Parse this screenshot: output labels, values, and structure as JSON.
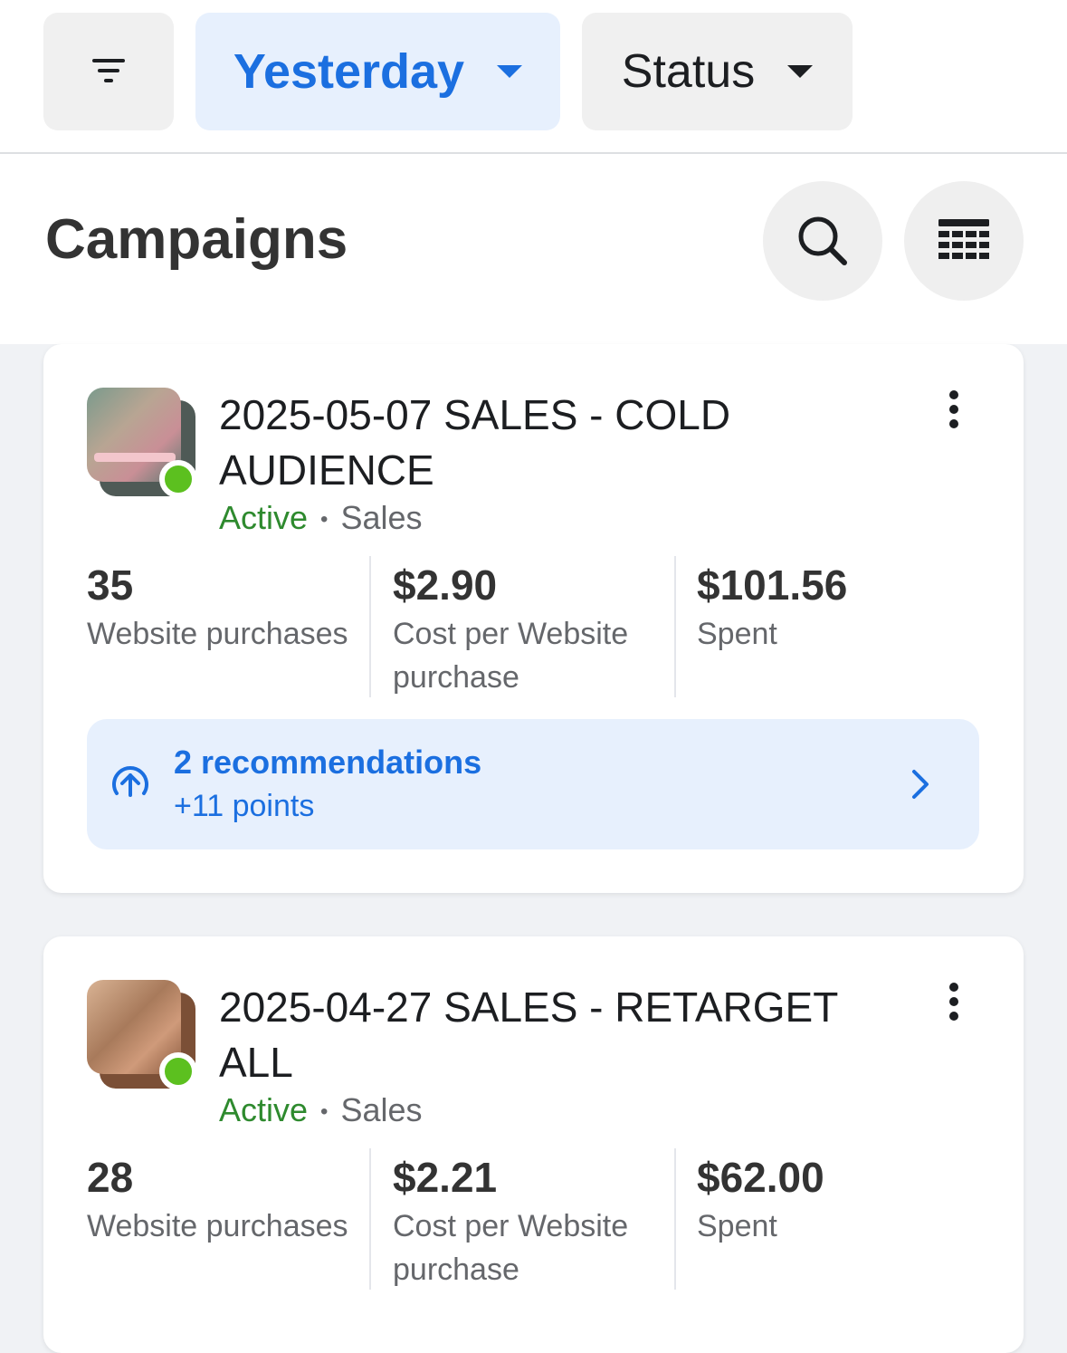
{
  "filters": {
    "filter_icon": "filter-lines-icon",
    "date_label": "Yesterday",
    "status_label": "Status"
  },
  "header": {
    "title": "Campaigns",
    "search_icon": "search-icon",
    "columns_icon": "table-columns-icon"
  },
  "campaigns": [
    {
      "name": "2025-05-07 SALES - COLD AUDIENCE",
      "status": "Active",
      "separator": "•",
      "objective": "Sales",
      "metrics": [
        {
          "value": "35",
          "label": "Website purchases"
        },
        {
          "value": "$2.90",
          "label": "Cost per Website purchase"
        },
        {
          "value": "$101.56",
          "label": "Spent"
        }
      ],
      "recommendation": {
        "title": "2 recommendations",
        "points": "+11 points"
      }
    },
    {
      "name": "2025-04-27 SALES - RETARGET ALL",
      "status": "Active",
      "separator": "•",
      "objective": "Sales",
      "metrics": [
        {
          "value": "28",
          "label": "Website purchases"
        },
        {
          "value": "$2.21",
          "label": "Cost per Website purchase"
        },
        {
          "value": "$62.00",
          "label": "Spent"
        }
      ]
    }
  ],
  "colors": {
    "accent_blue": "#1b6fe0",
    "active_green": "#2e8a2e",
    "status_dot": "#5cc01f",
    "chip_selected_bg": "#e7f0fd"
  }
}
